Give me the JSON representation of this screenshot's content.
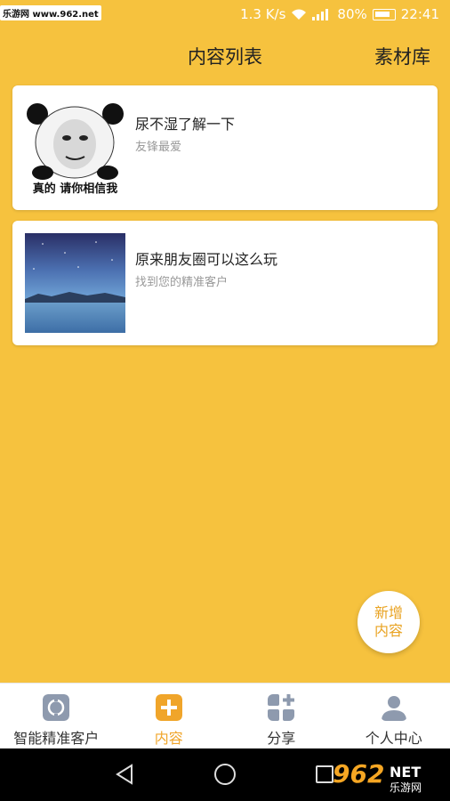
{
  "status_bar": {
    "watermark": "乐游网 www.962.net",
    "speed": "1.3 K/s",
    "battery": "80%",
    "time": "22:41"
  },
  "header": {
    "title": "内容列表",
    "right_action": "素材库"
  },
  "cards": [
    {
      "title": "尿不湿了解一下",
      "subtitle": "友锋最爱",
      "thumb_caption": "真的 请你相信我"
    },
    {
      "title": "原来朋友圈可以这么玩",
      "subtitle": "找到您的精准客户"
    }
  ],
  "fab": {
    "line1": "新增",
    "line2": "内容"
  },
  "tabs": [
    {
      "label": "智能精准客户",
      "icon": "target-icon"
    },
    {
      "label": "内容",
      "icon": "plus-icon",
      "active": true
    },
    {
      "label": "分享",
      "icon": "grid-plus-icon"
    },
    {
      "label": "个人中心",
      "icon": "person-icon"
    }
  ],
  "nav_logo": {
    "number": "962",
    "suffix": "NET",
    "site": "乐游网"
  },
  "colors": {
    "background": "#F6C23E",
    "accent": "#F0A52A"
  }
}
